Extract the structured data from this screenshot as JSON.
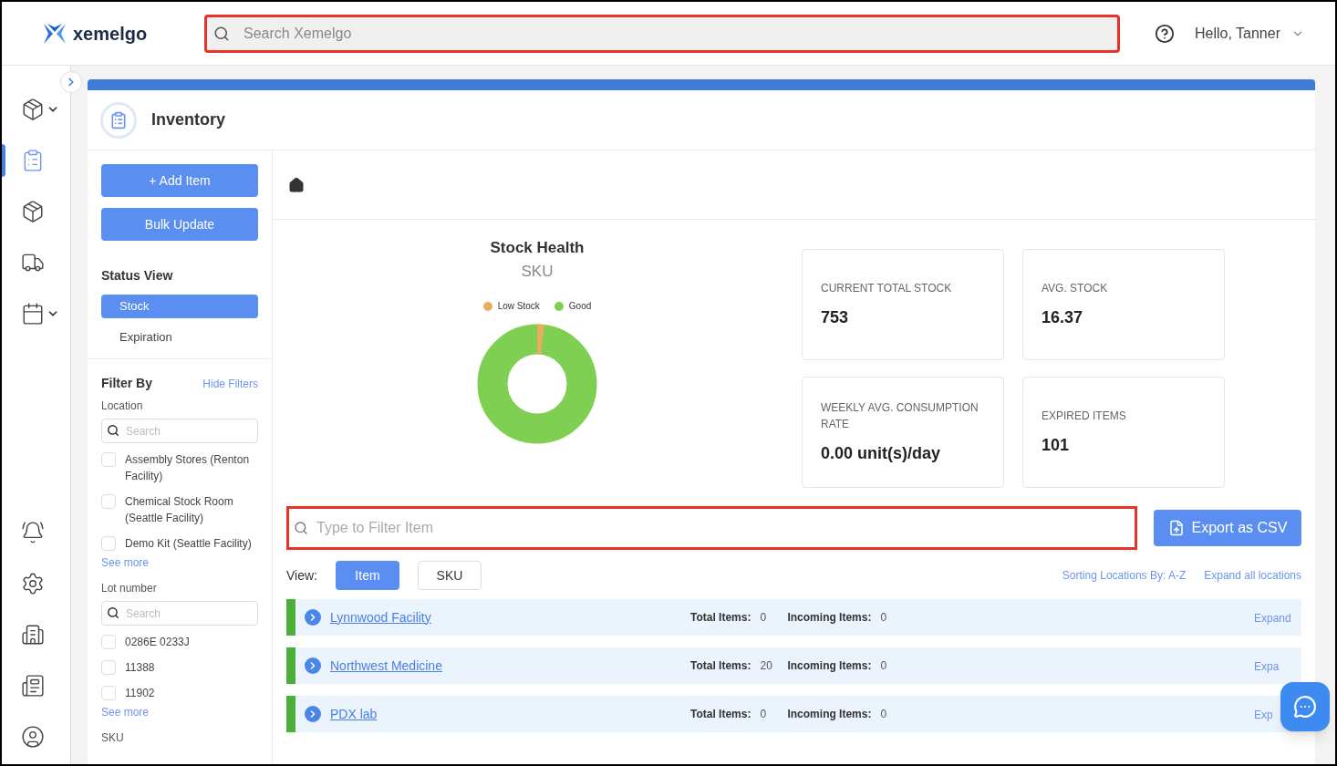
{
  "header": {
    "brand": "xemelgo",
    "search": {
      "placeholder": "Search Xemelgo",
      "highlighted": true
    },
    "greeting": "Hello, Tanner"
  },
  "nav": {
    "top": [
      {
        "kind": "tag-box",
        "selected": false,
        "expandable": true
      },
      {
        "kind": "clipboard",
        "selected": true,
        "expandable": false
      },
      {
        "kind": "tag-box",
        "selected": false,
        "expandable": false
      },
      {
        "kind": "truck",
        "selected": false,
        "expandable": false
      },
      {
        "kind": "calendar",
        "selected": false,
        "expandable": true
      }
    ],
    "bottom": [
      {
        "kind": "bell",
        "selected": false,
        "expandable": false
      },
      {
        "kind": "settings",
        "selected": false,
        "expandable": false
      },
      {
        "kind": "building",
        "selected": false,
        "expandable": false
      },
      {
        "kind": "document",
        "selected": false,
        "expandable": false
      },
      {
        "kind": "user",
        "selected": false,
        "expandable": false
      }
    ]
  },
  "page": {
    "title": "Inventory"
  },
  "actions": [
    "+ Add Item",
    "Bulk Update"
  ],
  "status_view": {
    "title": "Status View",
    "options": [
      {
        "label": "Stock",
        "selected": true
      },
      {
        "label": "Expiration",
        "selected": false
      }
    ]
  },
  "filters": {
    "title": "Filter By",
    "toggle": "Hide Filters",
    "groups": [
      {
        "label": "Location",
        "search_placeholder": "Search",
        "options": [
          {
            "label": "Assembly Stores (Renton Facility)",
            "checked": false
          },
          {
            "label": "Chemical Stock Room (Seattle Facility)",
            "checked": false
          },
          {
            "label": "Demo Kit (Seattle Facility)",
            "checked": false
          }
        ],
        "more": "See more"
      },
      {
        "label": "Lot number",
        "search_placeholder": "Search",
        "options": [
          {
            "label": "0286E 0233J",
            "checked": false
          },
          {
            "label": "11388",
            "checked": false
          },
          {
            "label": "11902",
            "checked": false
          }
        ],
        "more": "See more"
      },
      {
        "label": "SKU"
      }
    ]
  },
  "stock_health": {
    "title": "Stock Health",
    "subtitle": "SKU",
    "legend": [
      {
        "label": "Low Stock",
        "color": "#e8ad5e"
      },
      {
        "label": "Good",
        "color": "#7ecf52"
      }
    ]
  },
  "metrics": [
    {
      "label": "CURRENT TOTAL STOCK",
      "value": "753"
    },
    {
      "label": "AVG. STOCK",
      "value": "16.37"
    },
    {
      "label": "WEEKLY AVG. CONSUMPTION RATE",
      "value": "0.00 unit(s)/day"
    },
    {
      "label": "EXPIRED ITEMS",
      "value": "101"
    }
  ],
  "filter_field": {
    "placeholder": "Type to Filter Item",
    "highlighted": true
  },
  "export": "Export as CSV",
  "view": {
    "label": "View:",
    "options": [
      {
        "label": "Item",
        "selected": true
      },
      {
        "label": "SKU",
        "selected": false
      }
    ]
  },
  "sorting": "Sorting Locations By: A-Z",
  "expand_all": "Expand all locations",
  "locations": [
    {
      "name": "Lynnwood Facility",
      "total_label": "Total Items:",
      "total": "0",
      "incoming_label": "Incoming Items:",
      "incoming": "0",
      "action": "Expand",
      "color": "#4caf3c"
    },
    {
      "name": "Northwest Medicine",
      "total_label": "Total Items:",
      "total": "20",
      "incoming_label": "Incoming Items:",
      "incoming": "0",
      "action": "Expa",
      "color": "#4caf3c"
    },
    {
      "name": "PDX lab",
      "total_label": "Total Items:",
      "total": "0",
      "incoming_label": "Incoming Items:",
      "incoming": "0",
      "action": "Exp",
      "color": "#4caf3c"
    }
  ]
}
